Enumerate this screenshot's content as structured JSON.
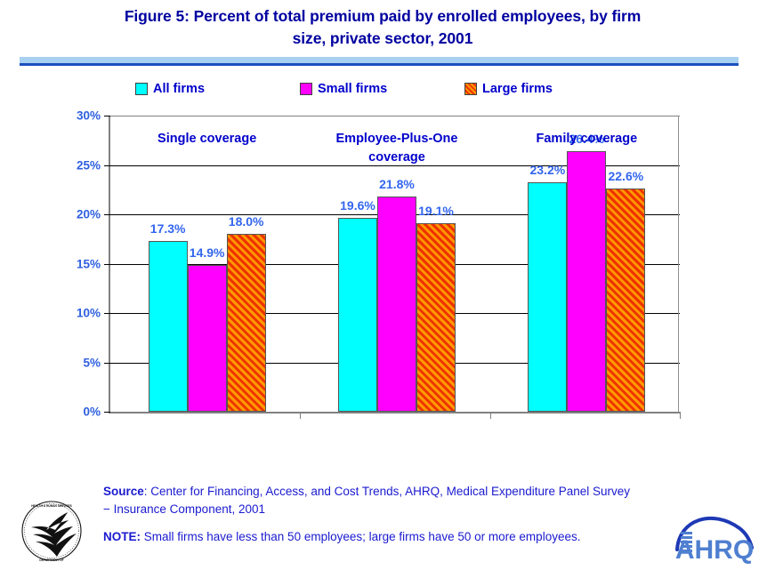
{
  "chart_data": {
    "type": "bar",
    "title": "Figure 5: Percent of total premium paid by enrolled employees, by firm size, private sector, 2001",
    "xlabel": "",
    "ylabel": "",
    "ylim": [
      0,
      30
    ],
    "ytick_labels": [
      "0%",
      "5%",
      "10%",
      "15%",
      "20%",
      "25%",
      "30%"
    ],
    "ytick_values": [
      0,
      5,
      10,
      15,
      20,
      25,
      30
    ],
    "grid": true,
    "legend_position": "top",
    "categories": [
      "Single coverage",
      "Employee-Plus-One coverage",
      "Family coverage"
    ],
    "series": [
      {
        "name": "All firms",
        "color": "#00FFFF",
        "values": [
          17.3,
          19.6,
          23.2
        ],
        "labels": [
          "17.3%",
          "19.6%",
          "23.2%"
        ]
      },
      {
        "name": "Small firms",
        "color": "#FF00FF",
        "values": [
          14.9,
          21.8,
          26.4
        ],
        "labels": [
          "14.9%",
          "21.8%",
          "26.4%"
        ]
      },
      {
        "name": "Large firms",
        "color": "#FF9900",
        "values": [
          18.0,
          19.1,
          22.6
        ],
        "labels": [
          "18.0%",
          "19.1%",
          "22.6%"
        ]
      }
    ]
  },
  "title": {
    "line1": "Figure 5: Percent of total premium paid by enrolled employees, by firm",
    "line2": "size, private sector, 2001"
  },
  "legend": {
    "items": [
      {
        "label": "All firms",
        "swatch": "cyan-swatch"
      },
      {
        "label": "Small firms",
        "swatch": "magenta-swatch"
      },
      {
        "label": "Large firms",
        "swatch": "orange-hatch-swatch"
      }
    ]
  },
  "axis": {
    "y_labels": [
      "30%",
      "25%",
      "20%",
      "15%",
      "10%",
      "5%",
      "0%"
    ],
    "x_labels": [
      {
        "line1": "Single coverage",
        "line2": ""
      },
      {
        "line1": "Employee-Plus-One",
        "line2": "coverage"
      },
      {
        "line1": "Family coverage",
        "line2": ""
      }
    ]
  },
  "footnotes": {
    "source_label": "Source",
    "source_text": ": Center for Financing, Access, and Cost Trends, AHRQ, Medical Expenditure Panel Survey − Insurance Component, 2001",
    "note_label": "NOTE:",
    "note_text": " Small firms have less than 50 employees; large firms have 50 or more employees."
  },
  "logos": {
    "hhs": "hhs-seal",
    "ahrq": "ahrq-logo",
    "ahrq_text": "AHRQ"
  },
  "colors": {
    "title": "#0000A0",
    "label": "#0000CC",
    "value": "#3366EE",
    "all_firms": "#00FFFF",
    "small_firms": "#FF00FF",
    "large_firms": "#FF9900",
    "divider_light": "#A8D0F0",
    "divider_dark": "#1B4FBF"
  }
}
